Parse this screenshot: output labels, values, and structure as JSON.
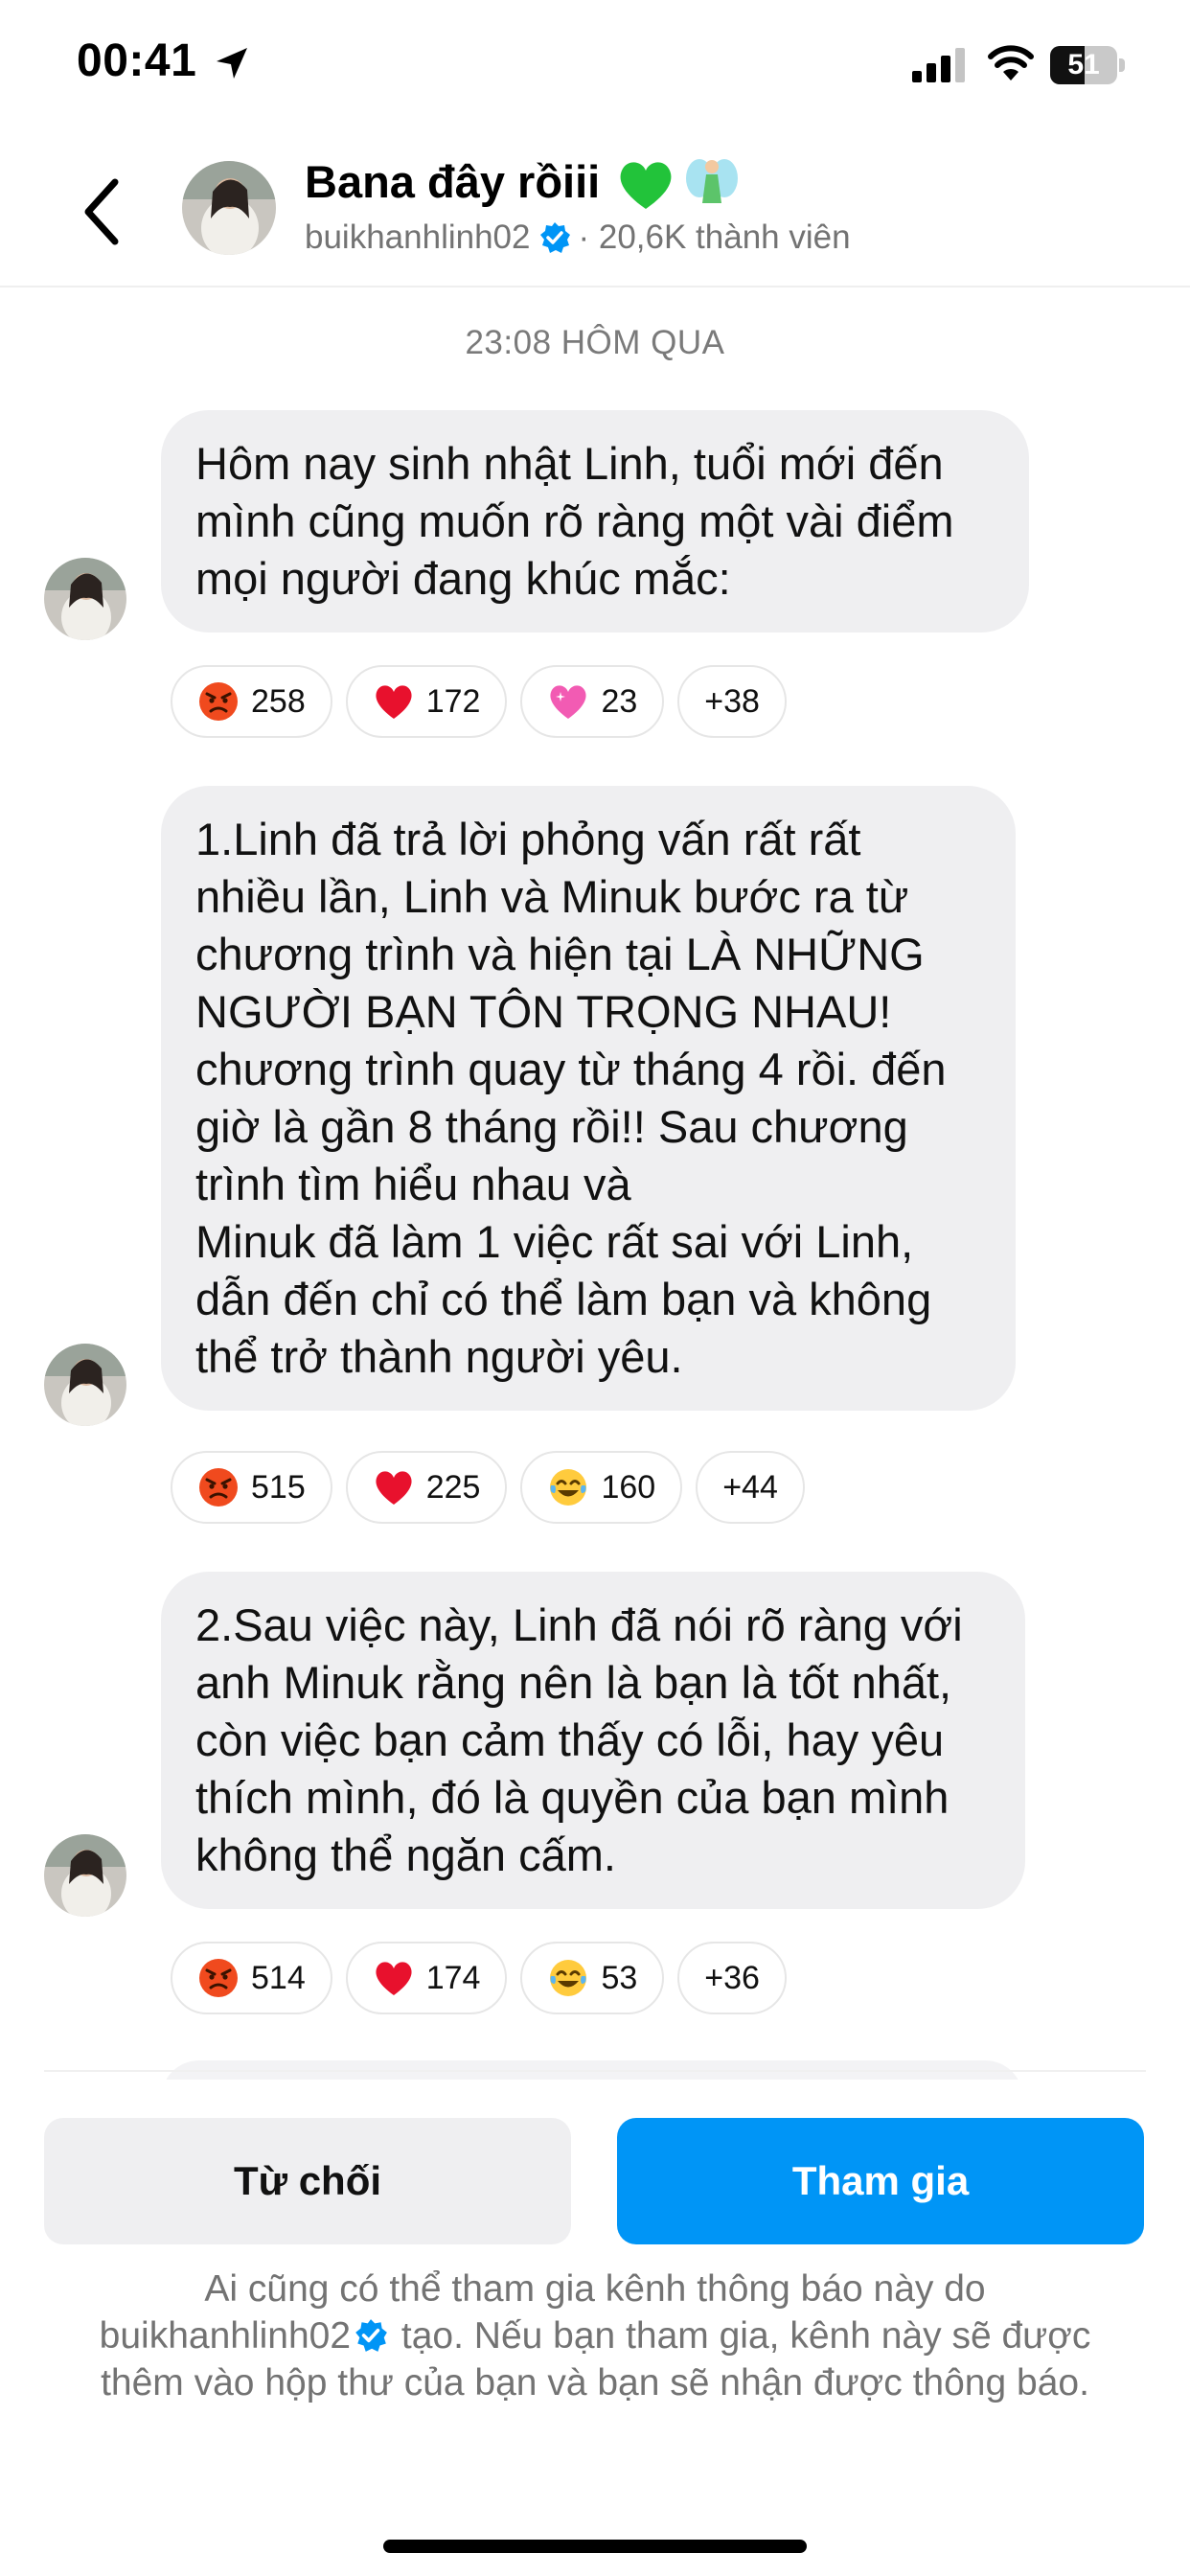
{
  "status_bar": {
    "time": "00:41",
    "battery_level": "51",
    "battery_fraction": 0.51
  },
  "header": {
    "title": "Bana đây rồiii",
    "title_emoji": [
      "green-heart",
      "fairy"
    ],
    "username": "buikhanhlinh02",
    "members": "· 20,6K thành viên"
  },
  "chat": {
    "timestamp": "23:08 HÔM QUA",
    "messages": [
      {
        "lines": [
          "Hôm nay sinh nhật Linh, tuổi mới đến",
          "mình cũng muốn rõ ràng một vài điểm",
          "mọi người đang khúc mắc:"
        ],
        "reactions": [
          {
            "emoji": "angry-face",
            "count": "258"
          },
          {
            "emoji": "red-heart",
            "count": "172"
          },
          {
            "emoji": "sparkling-heart",
            "count": "23"
          },
          {
            "emoji": "",
            "count": "+38"
          }
        ]
      },
      {
        "lines": [
          "1.Linh đã trả lời phỏng vấn rất rất",
          "nhiều lần, Linh và Minuk bước ra từ",
          "chương trình và hiện tại LÀ NHỮNG",
          "NGƯỜI BẠN TÔN TRỌNG NHAU!",
          "chương trình quay từ tháng 4 rồi. đến",
          "giờ là gần 8 tháng rồi!! Sau chương",
          "trình tìm hiểu nhau và",
          "Minuk đã làm 1 việc rất sai với Linh,",
          "dẫn đến chỉ có thể làm bạn và không",
          "thể trở thành người yêu."
        ],
        "reactions": [
          {
            "emoji": "angry-face",
            "count": "515"
          },
          {
            "emoji": "red-heart",
            "count": "225"
          },
          {
            "emoji": "tears-of-joy",
            "count": "160"
          },
          {
            "emoji": "",
            "count": "+44"
          }
        ]
      },
      {
        "lines": [
          "2.Sau việc này, Linh đã nói rõ ràng với",
          "anh Minuk rằng nên là bạn là tốt nhất,",
          "còn việc bạn cảm thấy có lỗi, hay yêu",
          "thích mình, đó là quyền của bạn mình",
          "không thể ngăn cấm."
        ],
        "reactions": [
          {
            "emoji": "angry-face",
            "count": "514"
          },
          {
            "emoji": "red-heart",
            "count": "174"
          },
          {
            "emoji": "tears-of-joy",
            "count": "53"
          },
          {
            "emoji": "",
            "count": "+36"
          }
        ]
      }
    ]
  },
  "actions": {
    "decline_label": "Từ chối",
    "join_label": "Tham gia"
  },
  "notice": {
    "line1": "Ai cũng có thể tham gia kênh thông báo này do",
    "username": "buikhanhlinh02",
    "line2_rest": " tạo. Nếu bạn tham gia, kênh này sẽ được",
    "line3": "thêm vào hộp thư của bạn và bạn sẽ nhận được thông báo."
  },
  "colors": {
    "accent": "#0095f6",
    "bubble": "#efeff1",
    "secondary_text": "#737373",
    "verified": "#0095f6"
  }
}
